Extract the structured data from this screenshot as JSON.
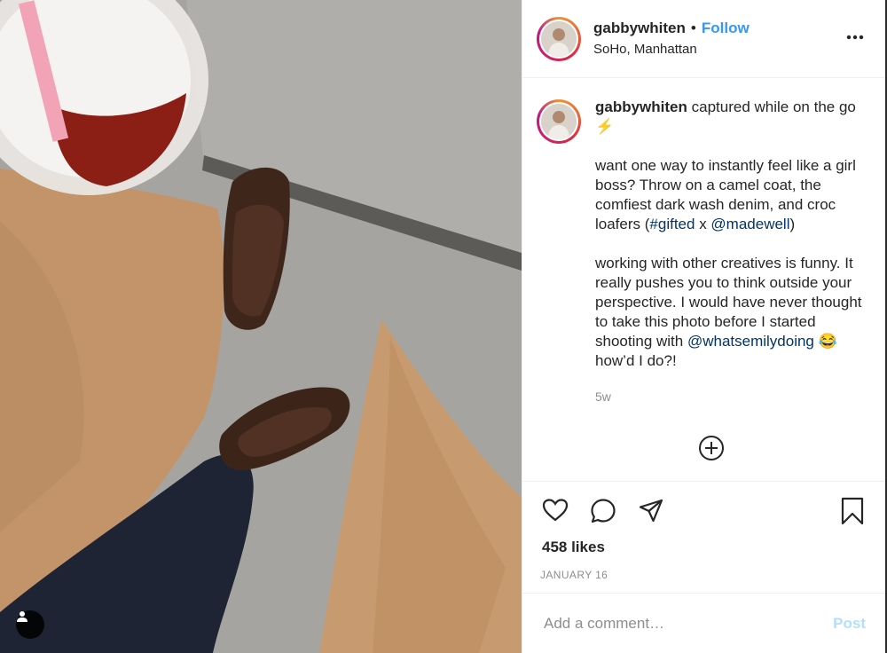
{
  "post": {
    "username": "gabbywhiten",
    "follow_label": "Follow",
    "dot": "•",
    "location": "SoHo, Manhattan",
    "more_icon": "more-horizontal-icon"
  },
  "caption": {
    "username": "gabbywhiten",
    "intro": " captured while on the go ",
    "intro_emoji": "⚡",
    "para1_text": "want one way to instantly feel like a girl boss? Throw on a camel coat, the comfiest dark wash denim, and croc loafers (",
    "hashtag": "#gifted",
    "para1_between": " x ",
    "mention1": "@madewell",
    "para1_end": ")",
    "para2_text": "working with other creatives is funny. It really pushes you to think outside your perspective. I would have never thought to take this photo before I started shooting with ",
    "mention2": "@whatsemilydoing",
    "para2_emoji": "😂",
    "para2_end": " how’d I do?!",
    "age": "5w"
  },
  "actions": {
    "likes": "458 likes",
    "date": "JANUARY 16",
    "icons": [
      "heart-icon",
      "comment-icon",
      "share-icon",
      "bookmark-icon"
    ]
  },
  "comment": {
    "placeholder": "Add a comment…",
    "post_label": "Post"
  },
  "colors": {
    "link": "#003569",
    "follow": "#3897f0",
    "post_disabled": "#b2dffc",
    "muted": "#8e8e8e"
  }
}
